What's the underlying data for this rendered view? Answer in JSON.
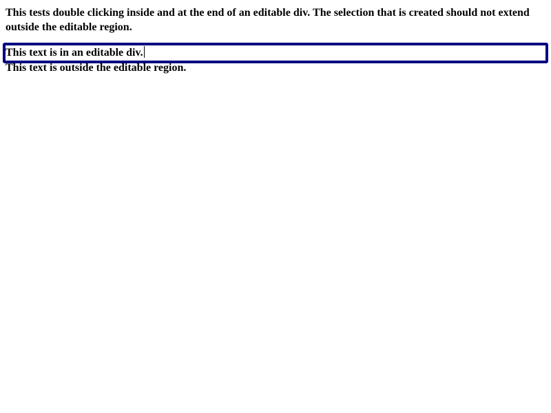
{
  "description": "This tests double clicking inside and at the end of an editable div. The selection that is created should not extend outside the editable region.",
  "editable": {
    "text": "This text is in an editable div.",
    "border_color": "#000080"
  },
  "outside": {
    "text": "This text is outside the editable region."
  }
}
